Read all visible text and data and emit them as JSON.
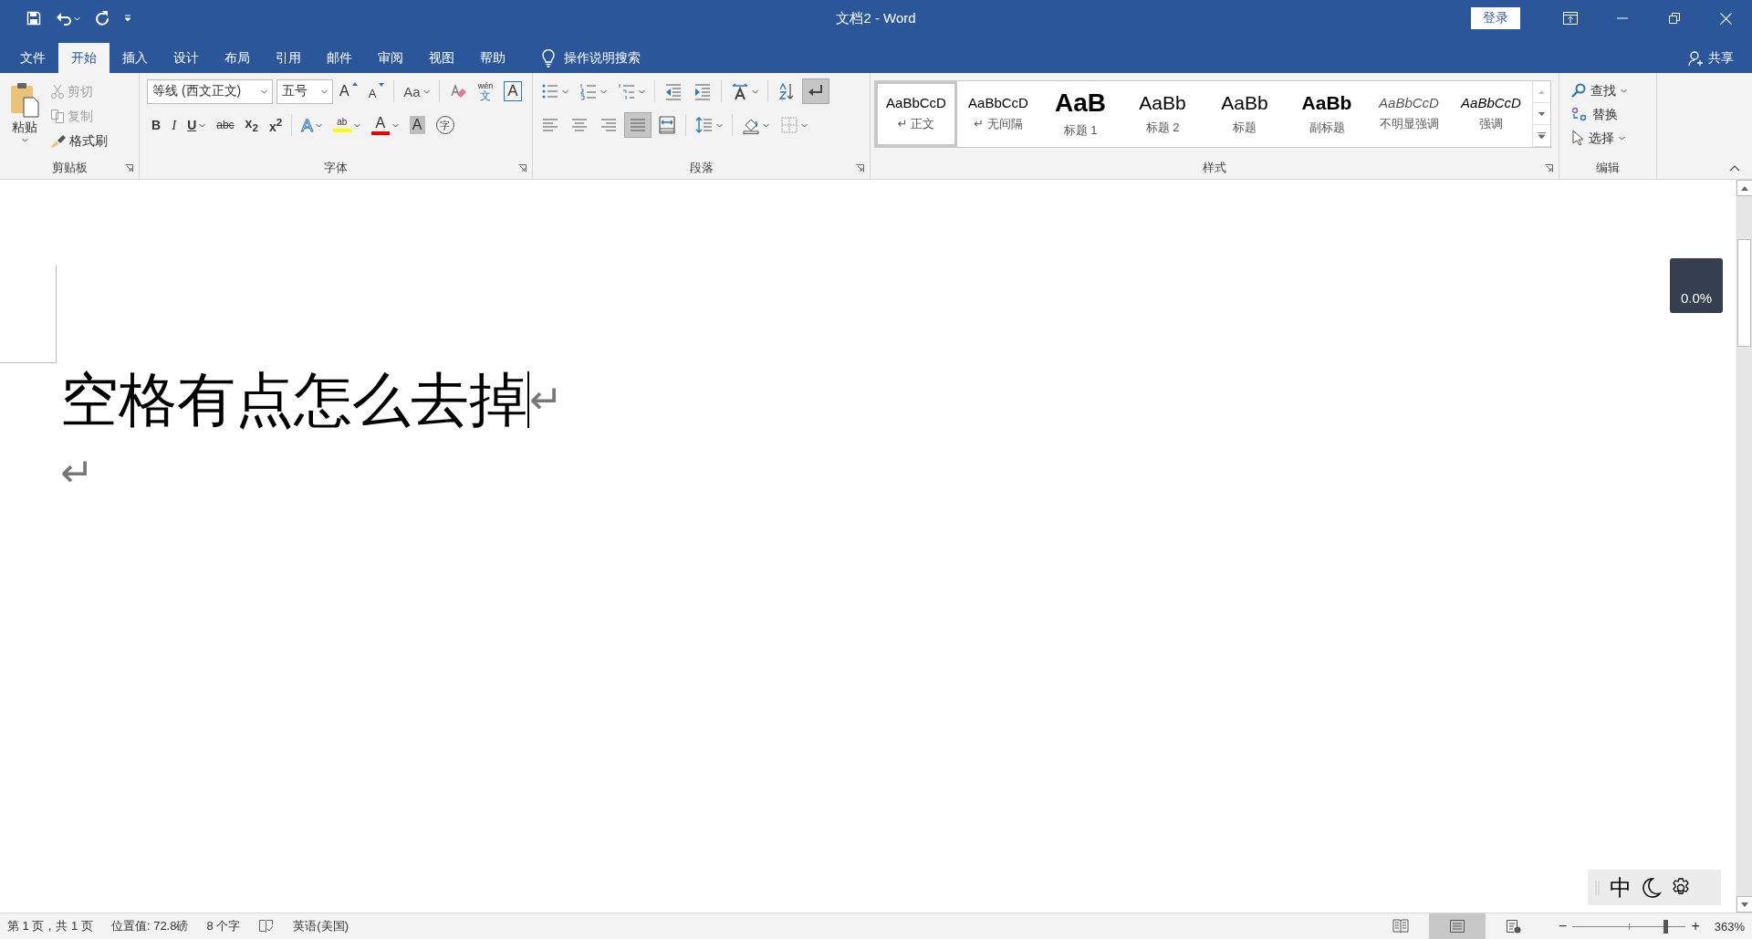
{
  "window": {
    "title": "文档2 - Word",
    "sign_in": "登录"
  },
  "quick_access": {
    "undo_menu": true
  },
  "tabs": [
    {
      "label": "文件",
      "selected": false
    },
    {
      "label": "开始",
      "selected": true
    },
    {
      "label": "插入",
      "selected": false
    },
    {
      "label": "设计",
      "selected": false
    },
    {
      "label": "布局",
      "selected": false
    },
    {
      "label": "引用",
      "selected": false
    },
    {
      "label": "邮件",
      "selected": false
    },
    {
      "label": "审阅",
      "selected": false
    },
    {
      "label": "视图",
      "selected": false
    },
    {
      "label": "帮助",
      "selected": false
    }
  ],
  "tell_me": {
    "label": "操作说明搜索"
  },
  "share": {
    "label": "共享"
  },
  "clipboard": {
    "label": "剪贴板",
    "paste": "粘贴",
    "cut": {
      "label": "剪切",
      "disabled": true
    },
    "copy": {
      "label": "复制",
      "disabled": true
    },
    "painter": {
      "label": "格式刷",
      "disabled": false
    }
  },
  "font": {
    "label": "字体",
    "name": "等线 (西文正文)",
    "size": "五号",
    "row1": [
      {
        "kind": "grow",
        "label": "A"
      },
      {
        "kind": "shrink",
        "label": "A"
      },
      {
        "kind": "case",
        "label": "Aa",
        "menu": true,
        "sep_before": true
      },
      {
        "kind": "clear",
        "sep_before": true
      },
      {
        "kind": "phonetic",
        "ruby": "wén",
        "label": "文"
      },
      {
        "kind": "border",
        "label": "A"
      }
    ],
    "row2": [
      {
        "kind": "bold",
        "label": "B"
      },
      {
        "kind": "italic",
        "label": "I"
      },
      {
        "kind": "underline",
        "label": "U",
        "menu": true
      },
      {
        "kind": "strike",
        "label": "abc"
      },
      {
        "kind": "sub",
        "label": "x$_{2}$"
      },
      {
        "kind": "sup",
        "label": "x$^{2}$"
      },
      {
        "kind": "effects",
        "label": "A",
        "menu": true,
        "sep_before": true
      },
      {
        "kind": "highlight",
        "label": "ab",
        "menu": true
      },
      {
        "kind": "color",
        "label": "A",
        "menu": true
      },
      {
        "kind": "shading",
        "label": "A"
      },
      {
        "kind": "enclose",
        "label": "字"
      }
    ]
  },
  "paragraph": {
    "label": "段落",
    "row1": [
      {
        "kind": "bullets",
        "menu": true
      },
      {
        "kind": "numbering",
        "menu": true
      },
      {
        "kind": "multilevel",
        "menu": true
      },
      {
        "kind": "outdent",
        "sep_before": true
      },
      {
        "kind": "indent"
      },
      {
        "kind": "asian",
        "menu": true,
        "sep_before": true
      },
      {
        "kind": "sort",
        "sep_before": true
      },
      {
        "kind": "marks",
        "on": true
      }
    ],
    "row2": [
      {
        "kind": "left",
        "selected": false
      },
      {
        "kind": "center",
        "selected": false
      },
      {
        "kind": "right",
        "selected": false
      },
      {
        "kind": "justify",
        "selected": true
      },
      {
        "kind": "distributed",
        "selected": false
      },
      {
        "kind": "spacing",
        "menu": true,
        "sep_before": true
      },
      {
        "kind": "fill",
        "menu": true,
        "sep_before": true
      },
      {
        "kind": "borders",
        "menu": true
      }
    ]
  },
  "styles": {
    "label": "样式",
    "items": [
      {
        "kind": "normal",
        "preview": "AaBbCcD",
        "name": "↵ 正文",
        "selected": true
      },
      {
        "kind": "nospacing",
        "preview": "AaBbCcD",
        "name": "↵ 无间隔",
        "selected": false
      },
      {
        "kind": "heading1",
        "preview": "AaB",
        "name": "标题 1",
        "selected": false
      },
      {
        "kind": "heading2",
        "preview": "AaBb",
        "name": "标题 2",
        "selected": false
      },
      {
        "kind": "title",
        "preview": "AaBb",
        "name": "标题",
        "selected": false
      },
      {
        "kind": "subtitle",
        "preview": "AaBb",
        "name": "副标题",
        "selected": false
      },
      {
        "kind": "subtle",
        "preview": "AaBbCcD",
        "name": "不明显强调",
        "selected": false
      },
      {
        "kind": "emphasis",
        "preview": "AaBbCcD",
        "name": "强调",
        "selected": false
      }
    ]
  },
  "editing": {
    "label": "编辑",
    "find": "查找",
    "replace": "替换",
    "select": "选择"
  },
  "document": {
    "lines": [
      {
        "text": "空格有点怎么去掉",
        "mark": "↵",
        "cursor": true
      },
      {
        "mark": "↵",
        "cursor": false
      }
    ]
  },
  "progress_badge": "0.0%",
  "ime_bar": {
    "mode": "中"
  },
  "status_bar": {
    "page": "第 1 页，共 1 页",
    "position": "位置值: 72.8磅",
    "words": "8 个字",
    "language": "英语(美国)",
    "views": [
      {
        "kind": "read",
        "selected": false
      },
      {
        "kind": "print",
        "selected": true
      },
      {
        "kind": "web",
        "selected": false
      }
    ],
    "zoom_out": "−",
    "zoom_in": "+",
    "zoom": {
      "level": 0.82
    },
    "zoom_label": "363%"
  }
}
